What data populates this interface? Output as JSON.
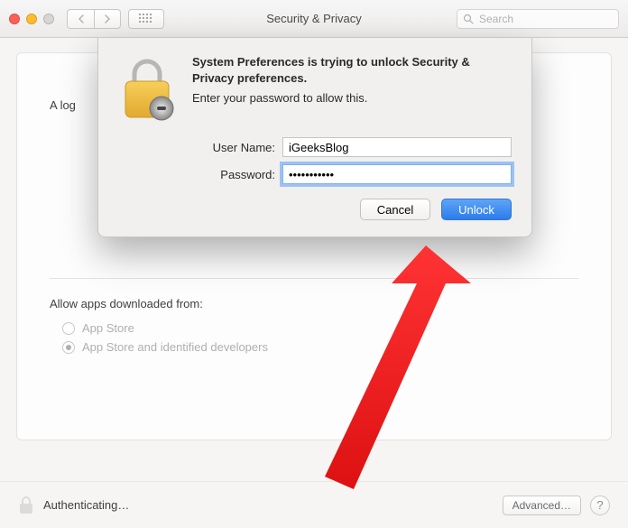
{
  "toolbar": {
    "title": "Security & Privacy",
    "search_placeholder": "Search"
  },
  "sheet": {
    "heading": "System Preferences is trying to unlock Security & Privacy preferences.",
    "subheading": "Enter your password to allow this.",
    "username_label": "User Name:",
    "username_value": "iGeeksBlog",
    "password_label": "Password:",
    "password_value": "•••••••••••",
    "cancel_label": "Cancel",
    "unlock_label": "Unlock"
  },
  "panel": {
    "login_label_prefix": "A log",
    "allow_label": "Allow apps downloaded from:",
    "radio_appstore": "App Store",
    "radio_identified": "App Store and identified developers"
  },
  "footer": {
    "status": "Authenticating…",
    "advanced_label": "Advanced…",
    "help_label": "?"
  }
}
